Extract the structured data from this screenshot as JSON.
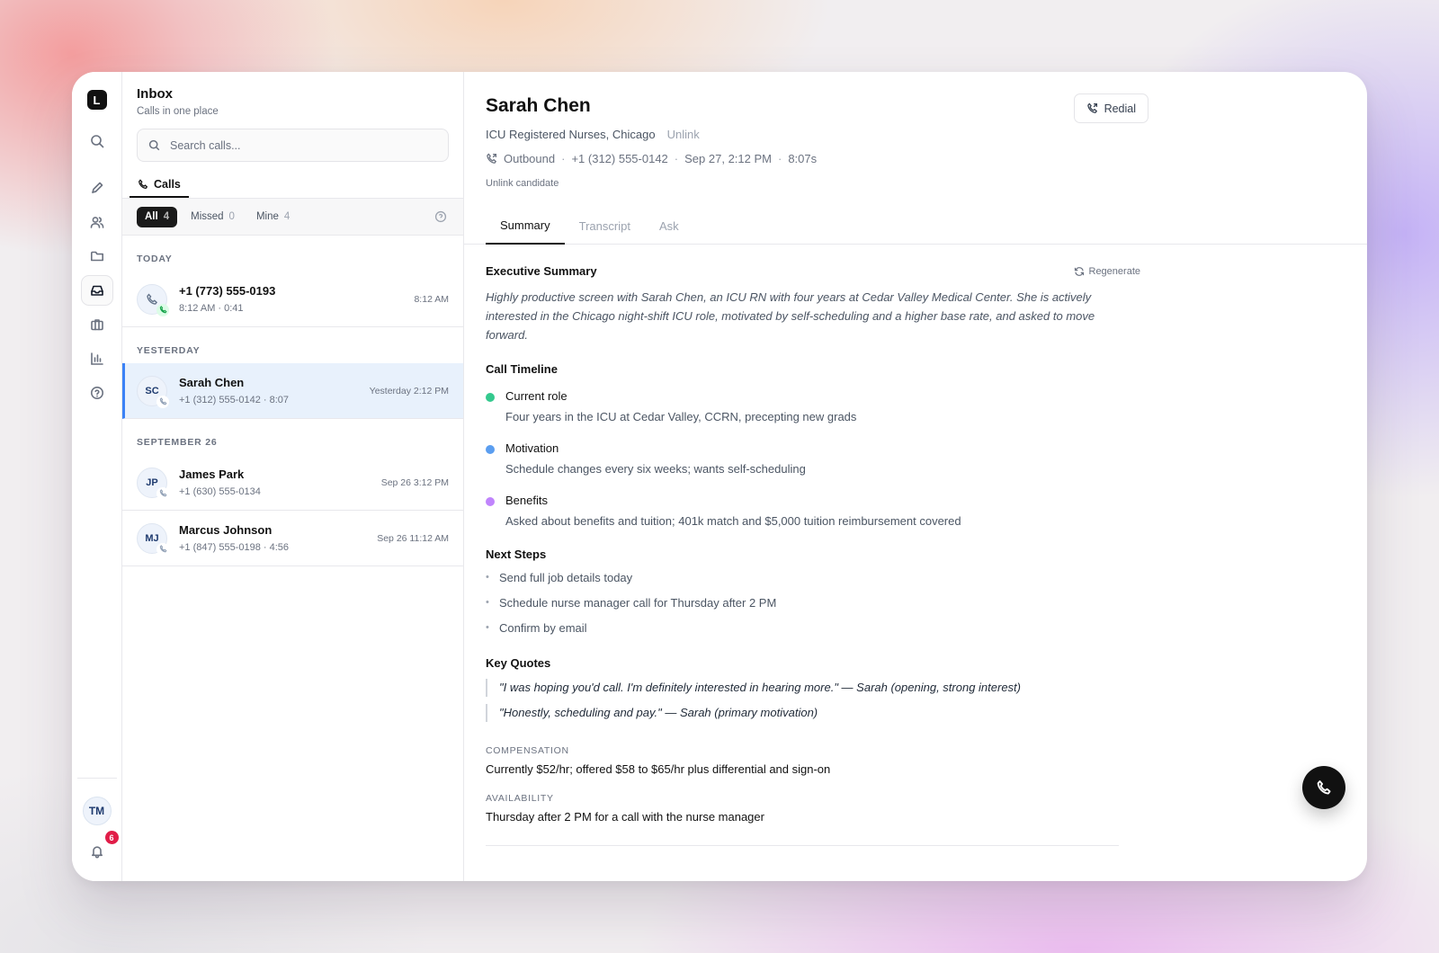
{
  "app": {
    "logo_letter": "L"
  },
  "rail": {
    "avatar_initials": "TM",
    "notification_count": "6"
  },
  "inbox": {
    "title": "Inbox",
    "subtitle": "Calls in one place",
    "search_placeholder": "Search calls...",
    "tab_label": "Calls",
    "filters": [
      {
        "label": "All",
        "count": "4"
      },
      {
        "label": "Missed",
        "count": "0"
      },
      {
        "label": "Mine",
        "count": "4"
      }
    ],
    "groups": [
      {
        "label": "TODAY"
      },
      {
        "label": "YESTERDAY"
      },
      {
        "label": "SEPTEMBER 26"
      }
    ],
    "calls": [
      {
        "initials": "",
        "name": "+1 (773) 555-0193",
        "meta": "8:12 AM  ·  0:41",
        "time": "8:12 AM"
      },
      {
        "initials": "SC",
        "name": "Sarah Chen",
        "meta": "+1 (312) 555-0142  ·  8:07",
        "time": "Yesterday 2:12 PM"
      },
      {
        "initials": "JP",
        "name": "James Park",
        "meta": "+1 (630) 555-0134",
        "time": "Sep 26 3:12 PM"
      },
      {
        "initials": "MJ",
        "name": "Marcus Johnson",
        "meta": "+1 (847) 555-0198  ·  4:56",
        "time": "Sep 26 11:12 AM"
      }
    ]
  },
  "detail": {
    "name": "Sarah Chen",
    "role": "ICU Registered Nurses, Chicago",
    "unlink": "Unlink",
    "direction": "Outbound",
    "phone": "+1 (312) 555-0142",
    "datetime": "Sep 27, 2:12 PM",
    "duration": "8:07s",
    "unlink_candidate": "Unlink candidate",
    "redial": "Redial",
    "tabs": [
      "Summary",
      "Transcript",
      "Ask"
    ],
    "regenerate": "Regenerate",
    "exec_title": "Executive Summary",
    "exec_summary": "Highly productive screen with Sarah Chen, an ICU RN with four years at Cedar Valley Medical Center. She is actively interested in the Chicago night-shift ICU role, motivated by self-scheduling and a higher base rate, and asked to move forward.",
    "timeline_title": "Call Timeline",
    "timeline": [
      {
        "title": "Current role",
        "desc": "Four years in the ICU at Cedar Valley, CCRN, precepting new grads",
        "color": "#34c98e"
      },
      {
        "title": "Motivation",
        "desc": "Schedule changes every six weeks; wants self-scheduling",
        "color": "#5b9ef0"
      },
      {
        "title": "Benefits",
        "desc": "Asked about benefits and tuition; 401k match and $5,000 tuition reimbursement covered",
        "color": "#c084fc"
      }
    ],
    "next_steps_title": "Next Steps",
    "next_steps": [
      "Send full job details today",
      "Schedule nurse manager call for Thursday after 2 PM",
      "Confirm by email"
    ],
    "quotes_title": "Key Quotes",
    "quotes": [
      "\"I was hoping you'd call. I'm definitely interested in hearing more.\" — Sarah (opening, strong interest)",
      "\"Honestly, scheduling and pay.\" — Sarah (primary motivation)"
    ],
    "compensation_label": "COMPENSATION",
    "compensation": "Currently $52/hr; offered $58 to $65/hr plus differential and sign-on",
    "availability_label": "AVAILABILITY",
    "availability": "Thursday after 2 PM for a call with the nurse manager"
  }
}
